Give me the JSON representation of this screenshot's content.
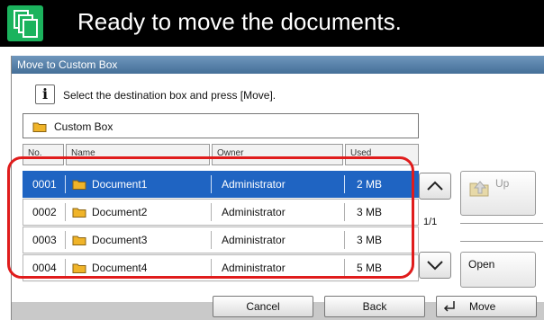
{
  "header": {
    "title": "Ready to move the documents."
  },
  "dialog": {
    "title": "Move to Custom Box",
    "instruction": "Select the destination box and press [Move].",
    "path": "Custom Box"
  },
  "table": {
    "columns": [
      "No.",
      "Name",
      "Owner",
      "Used"
    ],
    "rows": [
      {
        "no": "0001",
        "name": "Document1",
        "owner": "Administrator",
        "used": "2  MB"
      },
      {
        "no": "0002",
        "name": "Document2",
        "owner": "Administrator",
        "used": "3  MB"
      },
      {
        "no": "0003",
        "name": "Document3",
        "owner": "Administrator",
        "used": "3  MB"
      },
      {
        "no": "0004",
        "name": "Document4",
        "owner": "Administrator",
        "used": "5  MB"
      }
    ],
    "selected_row": 0
  },
  "pagination": {
    "page": "1/1"
  },
  "side": {
    "up_label": "Up",
    "open_label": "Open"
  },
  "footer": {
    "cancel_label": "Cancel",
    "back_label": "Back",
    "move_label": "Move"
  },
  "colors": {
    "selection": "#1f64c2",
    "highlight": "#e01c1c",
    "header_icon": "#1bb35d",
    "folder": "#f0b429"
  },
  "icons": [
    "copy-documents-icon",
    "info-icon",
    "folder-icon",
    "chevron-up-icon",
    "chevron-down-icon",
    "up-folder-icon",
    "enter-icon"
  ]
}
